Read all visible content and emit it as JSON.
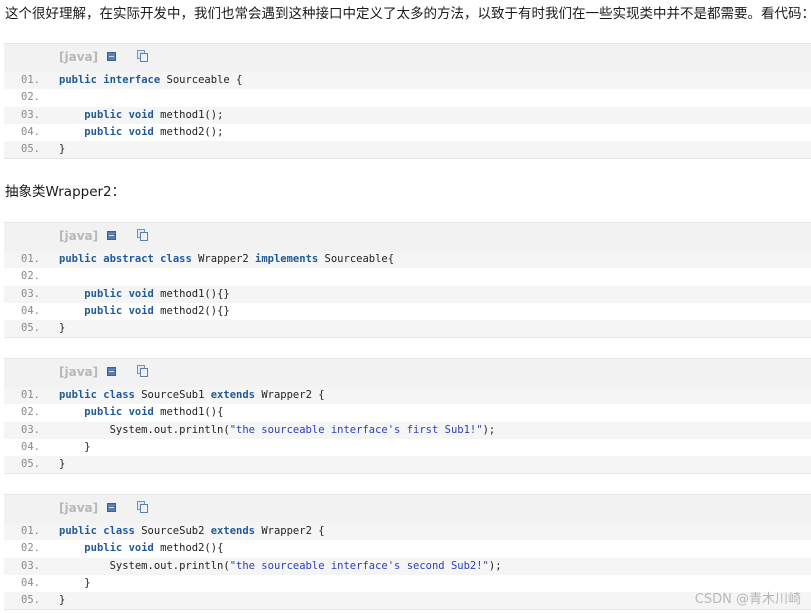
{
  "intro_text": "这个很好理解，在实际开发中，我们也常会遇到这种接口中定义了太多的方法，以致于有时我们在一些实现类中并不是都需要。看代码：",
  "abstract_label": "抽象类Wrapper2：",
  "lang_label": "[java]",
  "watermark": "CSDN @青木川崎",
  "blocks": [
    {
      "lines": [
        {
          "num": "01.",
          "tokens": [
            {
              "t": "public",
              "k": "kw"
            },
            {
              "t": " "
            },
            {
              "t": "interface",
              "k": "kw"
            },
            {
              "t": " Sourceable {"
            }
          ]
        },
        {
          "num": "02.",
          "tokens": []
        },
        {
          "num": "03.",
          "tokens": [
            {
              "t": "    "
            },
            {
              "t": "public",
              "k": "kw"
            },
            {
              "t": " "
            },
            {
              "t": "void",
              "k": "kw"
            },
            {
              "t": " method1();"
            }
          ]
        },
        {
          "num": "04.",
          "tokens": [
            {
              "t": "    "
            },
            {
              "t": "public",
              "k": "kw"
            },
            {
              "t": " "
            },
            {
              "t": "void",
              "k": "kw"
            },
            {
              "t": " method2();"
            }
          ]
        },
        {
          "num": "05.",
          "tokens": [
            {
              "t": "}"
            }
          ]
        }
      ]
    },
    {
      "lines": [
        {
          "num": "01.",
          "tokens": [
            {
              "t": "public",
              "k": "kw"
            },
            {
              "t": " "
            },
            {
              "t": "abstract",
              "k": "kw"
            },
            {
              "t": " "
            },
            {
              "t": "class",
              "k": "kw"
            },
            {
              "t": " Wrapper2 "
            },
            {
              "t": "implements",
              "k": "kw"
            },
            {
              "t": " Sourceable{"
            }
          ]
        },
        {
          "num": "02.",
          "tokens": []
        },
        {
          "num": "03.",
          "tokens": [
            {
              "t": "    "
            },
            {
              "t": "public",
              "k": "kw"
            },
            {
              "t": " "
            },
            {
              "t": "void",
              "k": "kw"
            },
            {
              "t": " method1(){}"
            }
          ]
        },
        {
          "num": "04.",
          "tokens": [
            {
              "t": "    "
            },
            {
              "t": "public",
              "k": "kw"
            },
            {
              "t": " "
            },
            {
              "t": "void",
              "k": "kw"
            },
            {
              "t": " method2(){}"
            }
          ]
        },
        {
          "num": "05.",
          "tokens": [
            {
              "t": "}"
            }
          ]
        }
      ]
    },
    {
      "lines": [
        {
          "num": "01.",
          "tokens": [
            {
              "t": "public",
              "k": "kw"
            },
            {
              "t": " "
            },
            {
              "t": "class",
              "k": "kw"
            },
            {
              "t": " SourceSub1 "
            },
            {
              "t": "extends",
              "k": "kw"
            },
            {
              "t": " Wrapper2 {"
            }
          ]
        },
        {
          "num": "02.",
          "tokens": [
            {
              "t": "    "
            },
            {
              "t": "public",
              "k": "kw"
            },
            {
              "t": " "
            },
            {
              "t": "void",
              "k": "kw"
            },
            {
              "t": " method1(){"
            }
          ]
        },
        {
          "num": "03.",
          "tokens": [
            {
              "t": "        System.out.println("
            },
            {
              "t": "\"the sourceable interface's first Sub1!\"",
              "k": "str"
            },
            {
              "t": ");"
            }
          ]
        },
        {
          "num": "04.",
          "tokens": [
            {
              "t": "    }"
            }
          ]
        },
        {
          "num": "05.",
          "tokens": [
            {
              "t": "}"
            }
          ]
        }
      ]
    },
    {
      "lines": [
        {
          "num": "01.",
          "tokens": [
            {
              "t": "public",
              "k": "kw"
            },
            {
              "t": " "
            },
            {
              "t": "class",
              "k": "kw"
            },
            {
              "t": " SourceSub2 "
            },
            {
              "t": "extends",
              "k": "kw"
            },
            {
              "t": " Wrapper2 {"
            }
          ]
        },
        {
          "num": "02.",
          "tokens": [
            {
              "t": "    "
            },
            {
              "t": "public",
              "k": "kw"
            },
            {
              "t": " "
            },
            {
              "t": "void",
              "k": "kw"
            },
            {
              "t": " method2(){"
            }
          ]
        },
        {
          "num": "03.",
          "tokens": [
            {
              "t": "        System.out.println("
            },
            {
              "t": "\"the sourceable interface's second Sub2!\"",
              "k": "str"
            },
            {
              "t": ");"
            }
          ]
        },
        {
          "num": "04.",
          "tokens": [
            {
              "t": "    }"
            }
          ]
        },
        {
          "num": "05.",
          "tokens": [
            {
              "t": "}"
            }
          ]
        }
      ]
    }
  ]
}
